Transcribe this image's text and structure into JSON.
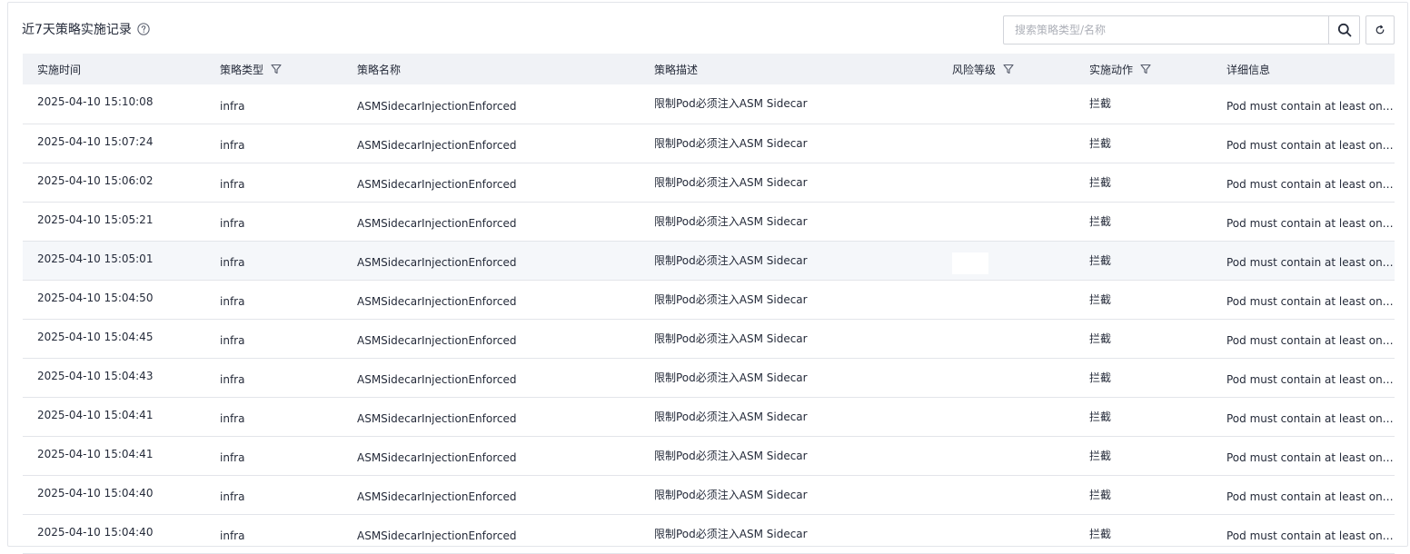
{
  "header": {
    "title": "近7天策略实施记录",
    "search_placeholder": "搜索策略类型/名称"
  },
  "table": {
    "columns": {
      "time": "实施时间",
      "type": "策略类型",
      "name": "策略名称",
      "desc": "策略描述",
      "risk": "风险等级",
      "action": "实施动作",
      "detail": "详细信息"
    },
    "rows": [
      {
        "time": "2025-04-10 15:10:08",
        "type": "infra",
        "name": "ASMSidecarInjectionEnforced",
        "desc": "限制Pod必须注入ASM Sidecar",
        "risk": "",
        "action": "拦截",
        "detail": "Pod must contain at least one ..."
      },
      {
        "time": "2025-04-10 15:07:24",
        "type": "infra",
        "name": "ASMSidecarInjectionEnforced",
        "desc": "限制Pod必须注入ASM Sidecar",
        "risk": "",
        "action": "拦截",
        "detail": "Pod must contain at least one ..."
      },
      {
        "time": "2025-04-10 15:06:02",
        "type": "infra",
        "name": "ASMSidecarInjectionEnforced",
        "desc": "限制Pod必须注入ASM Sidecar",
        "risk": "",
        "action": "拦截",
        "detail": "Pod must contain at least one ..."
      },
      {
        "time": "2025-04-10 15:05:21",
        "type": "infra",
        "name": "ASMSidecarInjectionEnforced",
        "desc": "限制Pod必须注入ASM Sidecar",
        "risk": "",
        "action": "拦截",
        "detail": "Pod must contain at least one ..."
      },
      {
        "time": "2025-04-10 15:05:01",
        "type": "infra",
        "name": "ASMSidecarInjectionEnforced",
        "desc": "限制Pod必须注入ASM Sidecar",
        "risk": "",
        "action": "拦截",
        "detail": "Pod must contain at least one ..."
      },
      {
        "time": "2025-04-10 15:04:50",
        "type": "infra",
        "name": "ASMSidecarInjectionEnforced",
        "desc": "限制Pod必须注入ASM Sidecar",
        "risk": "",
        "action": "拦截",
        "detail": "Pod must contain at least one ..."
      },
      {
        "time": "2025-04-10 15:04:45",
        "type": "infra",
        "name": "ASMSidecarInjectionEnforced",
        "desc": "限制Pod必须注入ASM Sidecar",
        "risk": "",
        "action": "拦截",
        "detail": "Pod must contain at least one ..."
      },
      {
        "time": "2025-04-10 15:04:43",
        "type": "infra",
        "name": "ASMSidecarInjectionEnforced",
        "desc": "限制Pod必须注入ASM Sidecar",
        "risk": "",
        "action": "拦截",
        "detail": "Pod must contain at least one ..."
      },
      {
        "time": "2025-04-10 15:04:41",
        "type": "infra",
        "name": "ASMSidecarInjectionEnforced",
        "desc": "限制Pod必须注入ASM Sidecar",
        "risk": "",
        "action": "拦截",
        "detail": "Pod must contain at least one ..."
      },
      {
        "time": "2025-04-10 15:04:41",
        "type": "infra",
        "name": "ASMSidecarInjectionEnforced",
        "desc": "限制Pod必须注入ASM Sidecar",
        "risk": "",
        "action": "拦截",
        "detail": "Pod must contain at least one ..."
      },
      {
        "time": "2025-04-10 15:04:40",
        "type": "infra",
        "name": "ASMSidecarInjectionEnforced",
        "desc": "限制Pod必须注入ASM Sidecar",
        "risk": "",
        "action": "拦截",
        "detail": "Pod must contain at least one ..."
      },
      {
        "time": "2025-04-10 15:04:40",
        "type": "infra",
        "name": "ASMSidecarInjectionEnforced",
        "desc": "限制Pod必须注入ASM Sidecar",
        "risk": "",
        "action": "拦截",
        "detail": "Pod must contain at least one ..."
      }
    ],
    "hovered_row": 4
  },
  "icons": {
    "help": "question-circle-icon",
    "search": "search-icon",
    "refresh": "refresh-icon",
    "filter": "filter-icon"
  },
  "colors": {
    "header_bg": "#f0f2f6",
    "row_border": "#e3e5ea",
    "hover_row_bg": "#f5f7fa",
    "text": "#252b3a",
    "placeholder": "#adb0b8"
  }
}
